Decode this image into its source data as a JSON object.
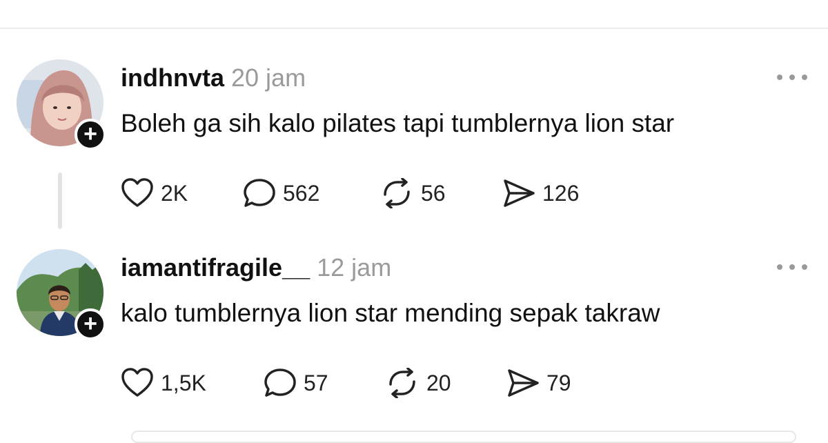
{
  "posts": [
    {
      "username": "indhnvta",
      "time": "20 jam",
      "text": "Boleh ga sih kalo pilates tapi tumblernya lion star",
      "likes": "2K",
      "replies": "562",
      "reposts": "56",
      "shares": "126"
    },
    {
      "username": "iamantifragile__",
      "time": "12 jam",
      "text": "kalo tumblernya lion star mending sepak takraw",
      "likes": "1,5K",
      "replies": "57",
      "reposts": "20",
      "shares": "79"
    }
  ],
  "icons": {
    "follow": "plus-icon",
    "more": "more-horizontal-icon",
    "like": "heart-icon",
    "reply": "comment-icon",
    "repost": "repost-icon",
    "share": "send-icon"
  },
  "colors": {
    "text": "#111111",
    "muted": "#9a9a9a",
    "divider": "#ececec",
    "badge": "#111111"
  },
  "follow_badge": "+"
}
